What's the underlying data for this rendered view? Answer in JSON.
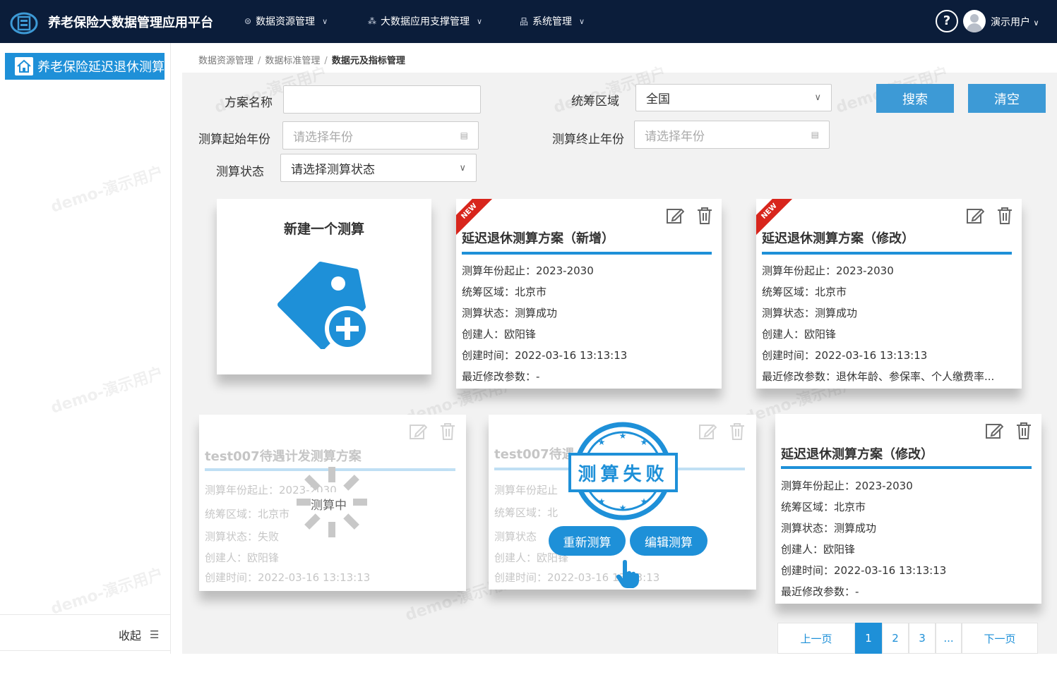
{
  "app": {
    "title": "养老保险大数据管理应用平台"
  },
  "nav": [
    {
      "label": "数据资源管理"
    },
    {
      "label": "大数据应用支撑管理"
    },
    {
      "label": "系统管理"
    }
  ],
  "user": {
    "name": "演示用户",
    "help": "?"
  },
  "sidebar": {
    "item": "养老保险延迟退休测算",
    "collapse": "收起"
  },
  "breadcrumb": [
    "数据资源管理",
    "数据标准管理",
    "数据元及指标管理"
  ],
  "watermark": "demo-演示用户",
  "filters": {
    "name_label": "方案名称",
    "name_value": "",
    "region_label": "统筹区域",
    "region_value": "全国",
    "start_label": "测算起始年份",
    "start_placeholder": "请选择年份",
    "end_label": "测算终止年份",
    "end_placeholder": "请选择年份",
    "status_label": "测算状态",
    "status_value": "请选择测算状态",
    "search": "搜索",
    "clear": "清空"
  },
  "new_card": {
    "title": "新建一个测算"
  },
  "cards": [
    {
      "badge": "NEW",
      "title": "延迟退休测算方案（新增）",
      "years": "测算年份起止：2023-2030",
      "region": "统筹区域：北京市",
      "status": "测算状态：测算成功",
      "creator": "创建人：欧阳锋",
      "created": "创建时间：2022-03-16 13:13:13",
      "modified": "最近修改参数：-"
    },
    {
      "badge": "NEW",
      "title": "延迟退休测算方案（修改）",
      "years": "测算年份起止：2023-2030",
      "region": "统筹区域：北京市",
      "status": "测算状态：测算成功",
      "creator": "创建人：欧阳锋",
      "created": "创建时间：2022-03-16 13:13:13",
      "modified": "最近修改参数：退休年龄、参保率、个人缴费率..."
    },
    {
      "title": "test007待遇计发测算方案",
      "years": "测算年份起止：2023-2030",
      "region": "统筹区域：北京市",
      "status": "测算状态：失败",
      "creator": "创建人：欧阳锋",
      "created": "创建时间：2022-03-16 13:13:13",
      "overlay": "测算中"
    },
    {
      "title": "test007待遇",
      "years": "测算年份起止",
      "region": "统筹区域：北",
      "status": "测算状态",
      "creator": "创建人：欧阳锋",
      "created": "创建时间：2022-03-16 13:13:13",
      "stamp": "测算失败",
      "retry": "重新测算",
      "edit": "编辑测算"
    },
    {
      "title": "延迟退休测算方案（修改）",
      "years": "测算年份起止：2023-2030",
      "region": "统筹区域：北京市",
      "status": "测算状态：测算成功",
      "creator": "创建人：欧阳锋",
      "created": "创建时间：2022-03-16 13:13:13",
      "modified": "最近修改参数：-"
    }
  ],
  "pagination": {
    "prev": "上一页",
    "pages": [
      "1",
      "2",
      "3"
    ],
    "ellipsis": "...",
    "next": "下一页",
    "current": 1
  },
  "colors": {
    "header": "#0b1d3a",
    "accent": "#1e90d8",
    "button": "#3d9ad6",
    "ribbon": "#d8251c"
  }
}
